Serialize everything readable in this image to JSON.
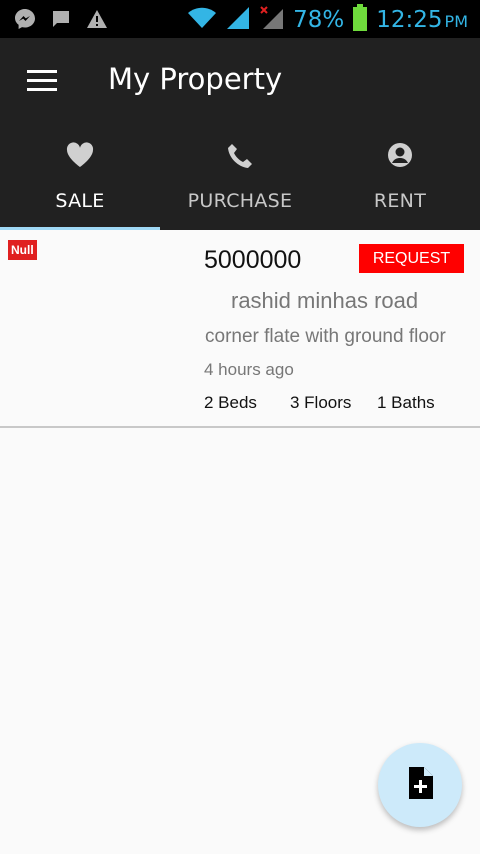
{
  "status_bar": {
    "battery_percent": "78%",
    "time": "12:25",
    "ampm": "PM",
    "icons": [
      "messenger-icon",
      "message-icon",
      "warning-icon",
      "wifi-icon",
      "signal-icon",
      "signal-noservice-icon",
      "battery-icon"
    ],
    "accent_color": "#33b5e5"
  },
  "toolbar": {
    "title": "My Property",
    "menu_icon": "hamburger-menu-icon",
    "background": "#212121"
  },
  "tabs": [
    {
      "label": "SALE",
      "icon": "heart-icon",
      "active": true
    },
    {
      "label": "PURCHASE",
      "icon": "phone-icon",
      "active": false
    },
    {
      "label": "RENT",
      "icon": "person-icon",
      "active": false
    }
  ],
  "listing": {
    "badge": "Null",
    "price": "5000000",
    "action_label": "REQUEST",
    "address": "rashid minhas road",
    "description": "corner flate with ground floor",
    "posted": "4 hours ago",
    "beds": "2 Beds",
    "floors": "3 Floors",
    "baths": "1 Baths"
  },
  "fab": {
    "icon": "add-document-icon",
    "color": "#cdeafa"
  }
}
